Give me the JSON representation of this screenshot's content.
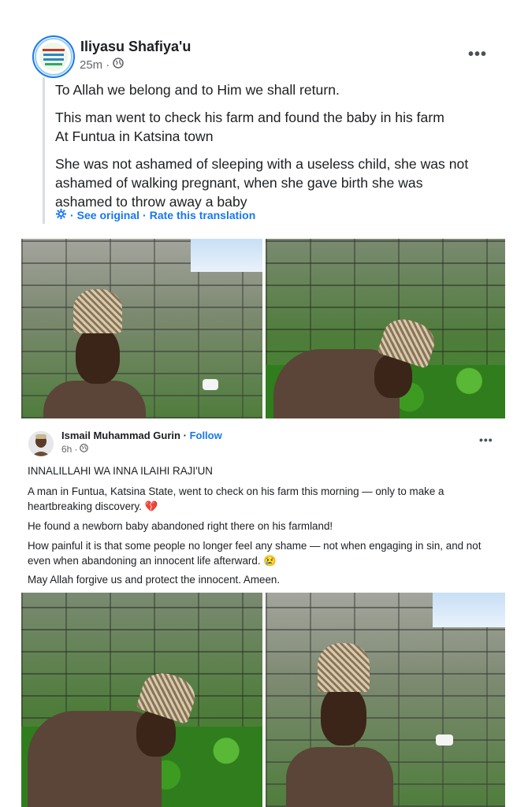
{
  "post1": {
    "author": "Iliyasu Shafiya'u",
    "time": "25m",
    "separator": "·",
    "menu": "•••",
    "paragraphs": [
      "To Allah we belong and to Him we shall return.",
      "This man went to check his farm and found the baby in his farm",
      "At Funtua in Katsina town",
      "She was not ashamed of sleeping with a useless child, she was not",
      "ashamed of walking pregnant, when she gave birth she was",
      "ashamed to throw away a baby"
    ],
    "see_original": "See original",
    "rate_translation": "Rate this translation"
  },
  "post2": {
    "author": "Ismail Muhammad Gurin",
    "follow": "Follow",
    "time": "6h",
    "separator": "·",
    "menu": "•••",
    "paragraphs": [
      "INNALILLAHI WA INNA ILAIHI RAJI'UN",
      "A man in Funtua, Katsina State, went to check on his farm this morning — only to make a",
      "heartbreaking discovery. 💔",
      "He found a newborn baby abandoned right there on his farmland!",
      "How painful it is that some people no longer feel any shame — not when engaging in sin, and not",
      "even when abandoning an innocent life afterward. 😢",
      "May Allah forgive us and protect the innocent. Ameen."
    ]
  },
  "icons": {
    "globe": "globe-icon",
    "gear": "gear-icon",
    "more": "more-options-icon"
  },
  "colors": {
    "link_blue": "#1877f2",
    "meta_grey": "#65676b",
    "text": "#1c1e21"
  }
}
